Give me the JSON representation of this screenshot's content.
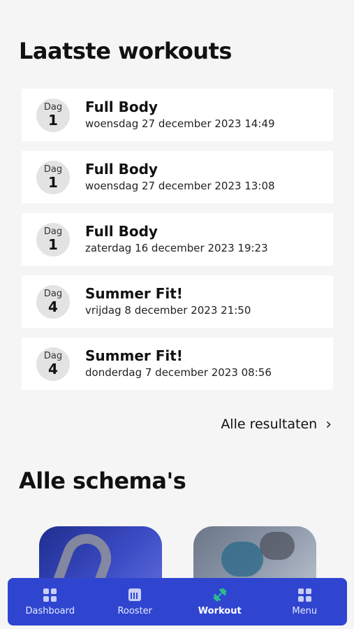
{
  "sections": {
    "latest_title": "Laatste workouts",
    "plans_title": "Alle schema's"
  },
  "workouts": [
    {
      "day_label": "Dag",
      "day": "1",
      "title": "Full Body",
      "date": "woensdag 27 december 2023 14:49"
    },
    {
      "day_label": "Dag",
      "day": "1",
      "title": "Full Body",
      "date": "woensdag 27 december 2023 13:08"
    },
    {
      "day_label": "Dag",
      "day": "1",
      "title": "Full Body",
      "date": "zaterdag 16 december 2023 19:23"
    },
    {
      "day_label": "Dag",
      "day": "4",
      "title": "Summer Fit!",
      "date": "vrijdag 8 december 2023 21:50"
    },
    {
      "day_label": "Dag",
      "day": "4",
      "title": "Summer Fit!",
      "date": "donderdag 7 december 2023 08:56"
    }
  ],
  "all_results": {
    "label": "Alle resultaten",
    "icon": "chevron-right-icon"
  },
  "tabbar": {
    "items": [
      {
        "label": "Dashboard",
        "icon": "dashboard-icon",
        "active": false
      },
      {
        "label": "Rooster",
        "icon": "calendar-icon",
        "active": false
      },
      {
        "label": "Workout",
        "icon": "dumbbell-icon",
        "active": true
      },
      {
        "label": "Menu",
        "icon": "menu-grid-icon",
        "active": false
      }
    ]
  },
  "colors": {
    "tabbar": "#2f45d0",
    "active_icon": "#29c28a",
    "background": "#f5f5f5"
  }
}
